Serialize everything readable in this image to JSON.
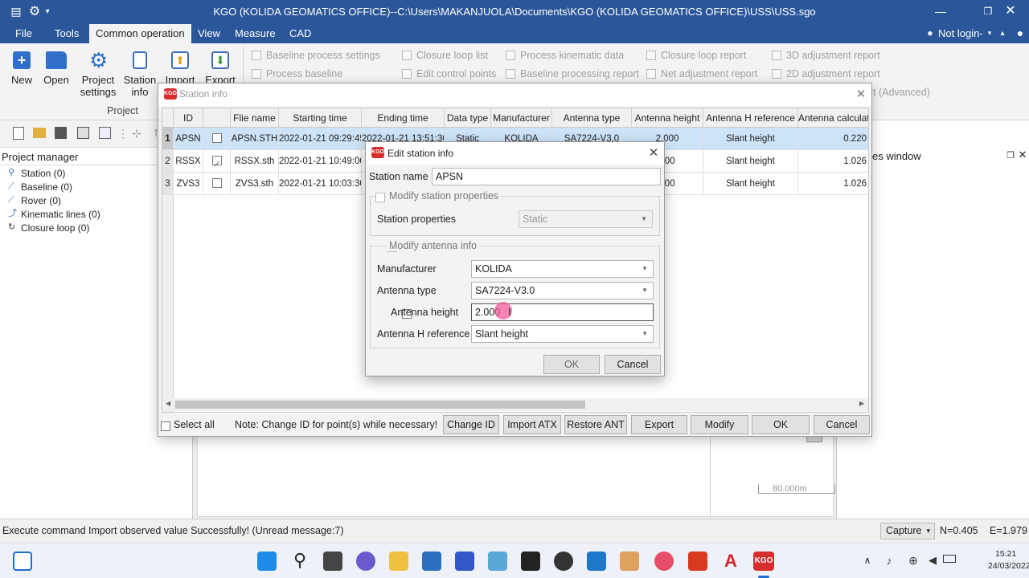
{
  "app": {
    "title": "KGO (KOLIDA GEOMATICS OFFICE)--C:\\Users\\MAKANJUOLA\\Documents\\KGO (KOLIDA GEOMATICS OFFICE)\\USS\\USS.sgo",
    "user_label": "Not login-",
    "colors": {
      "titlebar": "#2b579a",
      "ribbon": "#f3f3f3",
      "highlight_row": "#cde3f7",
      "cursor_dot": "#f05a9a"
    }
  },
  "menu": {
    "items": [
      "File",
      "Tools",
      "Common operation",
      "View",
      "Measure",
      "CAD"
    ],
    "active": "Common operation"
  },
  "ribbon": {
    "buttons": [
      {
        "label": "New",
        "icon": "new-icon"
      },
      {
        "label": "Open",
        "icon": "open-folder-icon"
      },
      {
        "label": "Project\nsettings",
        "icon": "gear-icon"
      },
      {
        "label": "Station\ninfo",
        "icon": "document-icon"
      },
      {
        "label": "Import",
        "icon": "import-icon"
      },
      {
        "label": "Export",
        "icon": "export-icon"
      }
    ],
    "group_label": "Project",
    "small_items": [
      "Baseline process settings",
      "Process baseline",
      "Closure loop list",
      "Edit control points",
      "Process kinematic data",
      "Baseline processing report",
      "Closure loop report",
      "Net adjustment report",
      "3D adjustment report",
      "2D adjustment report",
      "t (Advanced)"
    ]
  },
  "project_manager": {
    "title": "Project manager",
    "items": [
      "Station (0)",
      "Baseline (0)",
      "Rover (0)",
      "Kinematic lines (0)",
      "Closure loop (0)"
    ]
  },
  "right_panel": {
    "title": "es window"
  },
  "scale_label": "80.000m",
  "station_info": {
    "title": "Station info",
    "columns": [
      "ID",
      "",
      "Flie name",
      "Starting time",
      "Ending time",
      "Data type",
      "Manufacturer",
      "Antenna type",
      "Antenna height",
      "Antenna H reference",
      "Antenna calculati"
    ],
    "rows": [
      {
        "num": "1",
        "id": "APSN",
        "checked": false,
        "file": "APSN.STH",
        "start": "2022-01-21 09:29:45",
        "end": "2022-01-21 13:51:30",
        "type": "Static",
        "manufacturer": "KOLIDA",
        "antenna": "SA7224-V3.0",
        "height": "2.000",
        "href": "Slant height",
        "calc": "0.220"
      },
      {
        "num": "2",
        "id": "RSSX",
        "checked": true,
        "file": "RSSX.sth",
        "start": "2022-01-21 10:49:00",
        "end": "",
        "type": "",
        "manufacturer": "",
        "antenna": "",
        "height": "000",
        "href": "Slant height",
        "calc": "1.026"
      },
      {
        "num": "3",
        "id": "ZVS3",
        "checked": false,
        "file": "ZVS3.sth",
        "start": "2022-01-21 10:03:30",
        "end": "",
        "type": "",
        "manufacturer": "",
        "antenna": "",
        "height": "000",
        "href": "Slant height",
        "calc": "1.026"
      }
    ],
    "select_all": "Select all",
    "note": "Note: Change ID for point(s) while necessary!",
    "buttons": [
      "Change ID",
      "Import ATX",
      "Restore ANT",
      "Export",
      "Modify",
      "OK",
      "Cancel"
    ]
  },
  "edit_station": {
    "title": "Edit station info",
    "station_name_label": "Station name",
    "station_name_value": "APSN",
    "modify_props_label": "Modify station properties",
    "station_props_label": "Station properties",
    "station_props_value": "Static",
    "modify_antenna_label": "Modify antenna info",
    "manufacturer_label": "Manufacturer",
    "manufacturer_value": "KOLIDA",
    "antenna_type_label": "Antenna type",
    "antenna_type_value": "SA7224-V3.0",
    "antenna_height_label": "Antenna height",
    "antenna_height_value": "2.000",
    "href_label": "Antenna H reference",
    "href_value": "Slant height",
    "ok": "OK",
    "cancel": "Cancel"
  },
  "status": {
    "message": "Execute command Import observed value Successfully! (Unread message:7)",
    "capture": "Capture",
    "n": "N=0.405",
    "e": "E=1.979"
  },
  "taskbar": {
    "time": "15:21",
    "date": "24/03/2022",
    "kgo_label": "KGO"
  }
}
